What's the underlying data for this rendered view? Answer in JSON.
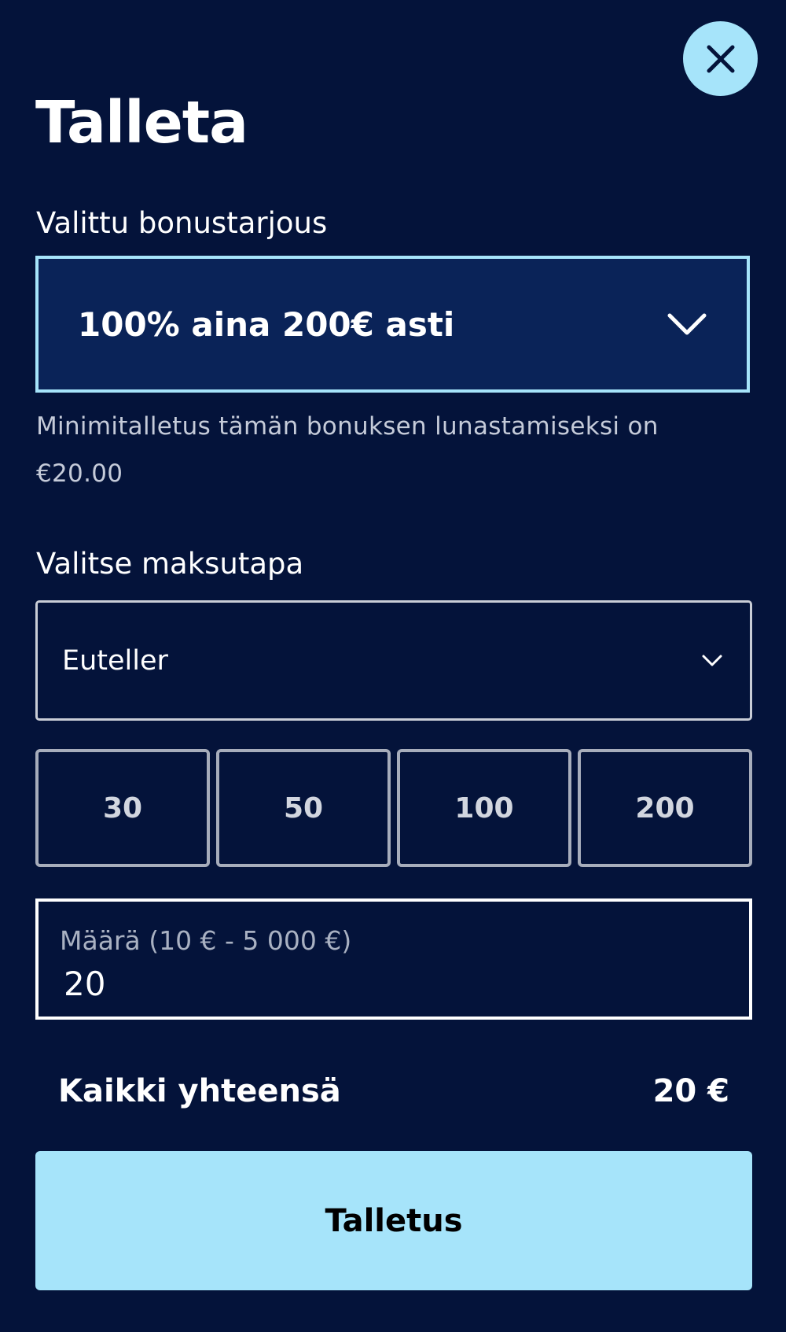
{
  "header": {
    "title": "Talleta",
    "close_icon": "close-icon"
  },
  "bonus": {
    "label": "Valittu bonustarjous",
    "selected": "100% aina 200€ asti",
    "icon": "chevron-down-icon",
    "hint": "Minimitalletus tämän bonuksen lunastamiseksi on €20.00"
  },
  "payment": {
    "label": "Valitse maksutapa",
    "selected": "Euteller",
    "icon": "chevron-down-icon"
  },
  "quick_amounts": [
    "30",
    "50",
    "100",
    "200"
  ],
  "amount": {
    "label": "Määrä (10 € - 5 000 €)",
    "value": "20"
  },
  "total": {
    "label": "Kaikki yhteensä",
    "value": "20 €"
  },
  "submit": {
    "label": "Talletus"
  },
  "colors": {
    "background": "#04133a",
    "accent": "#a6e4fa",
    "select_fill": "#0a2358"
  }
}
